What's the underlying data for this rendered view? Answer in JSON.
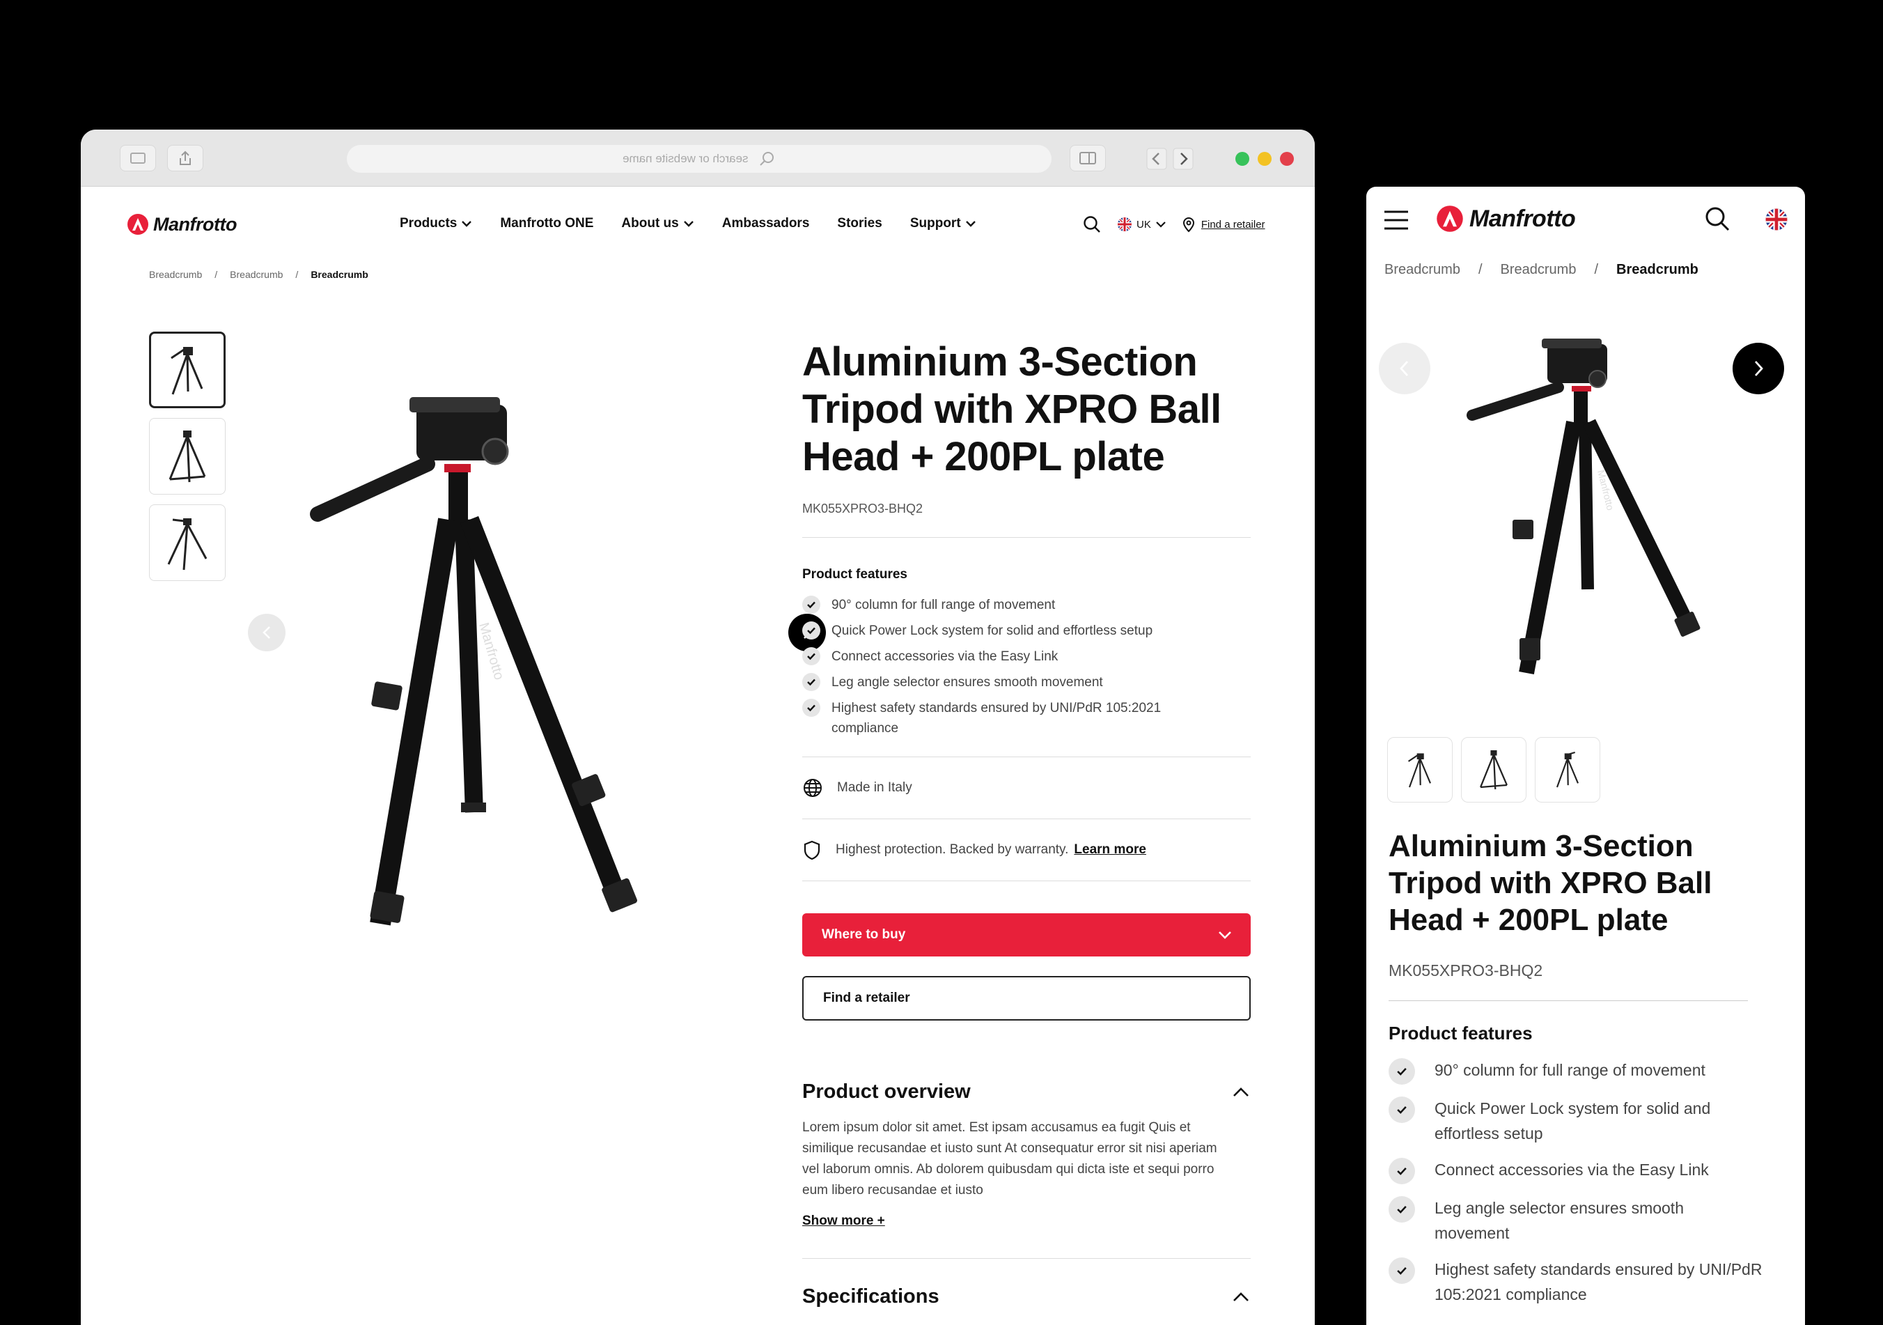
{
  "browser": {
    "url_placeholder": "search or website name"
  },
  "brand": {
    "name": "Manfrotto",
    "accent": "#e8203a"
  },
  "nav": {
    "items": [
      {
        "label": "Products",
        "dropdown": true
      },
      {
        "label": "Manfrotto ONE",
        "dropdown": false
      },
      {
        "label": "About us",
        "dropdown": true
      },
      {
        "label": "Ambassadors",
        "dropdown": false
      },
      {
        "label": "Stories",
        "dropdown": false
      },
      {
        "label": "Support",
        "dropdown": true
      }
    ],
    "locale": "UK",
    "find_retailer": "Find a retailer"
  },
  "breadcrumb": [
    "Breadcrumb",
    "Breadcrumb",
    "Breadcrumb"
  ],
  "product": {
    "title": "Aluminium 3-Section Tripod with XPRO Ball Head + 200PL plate",
    "sku": "MK055XPRO3-BHQ2",
    "features_heading": "Product features",
    "features": [
      "90° column for full range of movement",
      "Quick Power Lock system for solid and effortless setup",
      "Connect accessories via the Easy Link",
      "Leg angle selector ensures smooth movement",
      "Highest safety standards ensured by UNI/PdR 105:2021 compliance"
    ],
    "made_in": "Made in Italy",
    "warranty_text": "Highest protection. Backed by warranty.",
    "warranty_link": "Learn more",
    "where_to_buy": "Where to buy",
    "find_retailer": "Find a retailer"
  },
  "overview": {
    "heading": "Product overview",
    "text": "Lorem ipsum dolor sit amet. Est ipsam accusamus ea fugit Quis et similique recusandae et iusto sunt At consequatur error sit nisi aperiam vel laborum omnis. Ab dolorem quibusdam qui dicta iste et sequi porro eum libero recusandae et iusto",
    "show_more": "Show more +"
  },
  "specifications": {
    "heading": "Specifications"
  },
  "mobile": {
    "title": "Aluminium 3-Section Tripod with XPRO Ball Head + 200PL plate",
    "features": [
      "90° column for full range of movement",
      "Quick Power Lock system for solid and effortless setup",
      "Connect accessories via the Easy Link",
      "Leg angle selector ensures smooth movement",
      "Highest safety standards ensured by UNI/PdR 105:2021 compliance"
    ]
  }
}
